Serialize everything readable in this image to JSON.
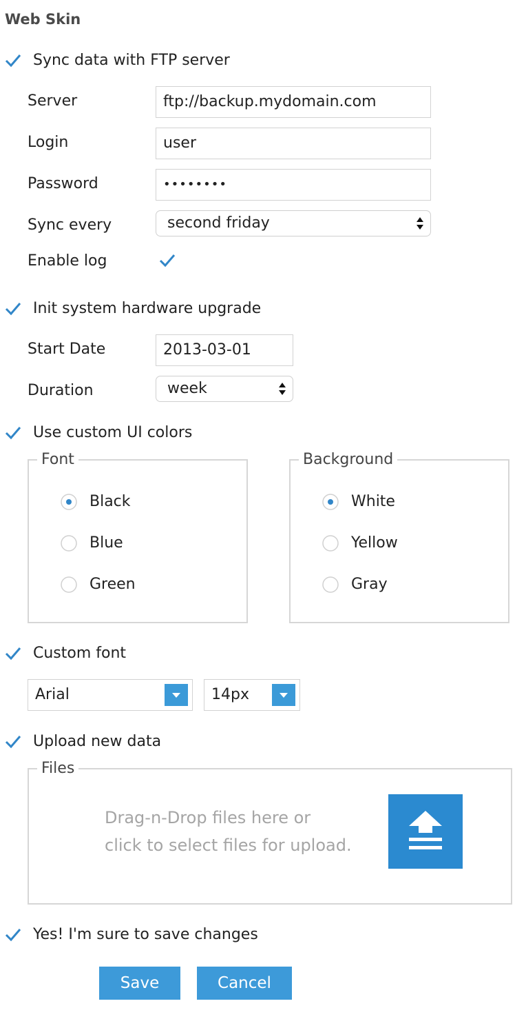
{
  "title": "Web Skin",
  "colors": {
    "accent": "#3b9ad8",
    "upload": "#2b8ad0",
    "check": "#3186c8",
    "border": "#d6d6d6",
    "hint": "#a5a5a5"
  },
  "ftp": {
    "checkbox_label": "Sync data with FTP server",
    "server_label": "Server",
    "server_value": "ftp://backup.mydomain.com",
    "login_label": "Login",
    "login_value": "user",
    "password_label": "Password",
    "password_value": "••••••••",
    "sync_label": "Sync every",
    "sync_value": "second friday",
    "log_label": "Enable log"
  },
  "upgrade": {
    "checkbox_label": "Init system hardware upgrade",
    "start_label": "Start Date",
    "start_value": "2013-03-01",
    "duration_label": "Duration",
    "duration_value": "week"
  },
  "colors_section": {
    "checkbox_label": "Use custom UI colors",
    "font_legend": "Font",
    "font_options": [
      "Black",
      "Blue",
      "Green"
    ],
    "background_legend": "Background",
    "background_options": [
      "White",
      "Yellow",
      "Gray"
    ]
  },
  "custom_font": {
    "checkbox_label": "Custom font",
    "family_value": "Arial",
    "size_value": "14px"
  },
  "upload": {
    "checkbox_label": "Upload new data",
    "files_legend": "Files",
    "hint_line1": "Drag-n-Drop files here or",
    "hint_line2": "click to select files for upload."
  },
  "confirm": {
    "checkbox_label": "Yes! I'm sure to save changes"
  },
  "buttons": {
    "save": "Save",
    "cancel": "Cancel"
  }
}
